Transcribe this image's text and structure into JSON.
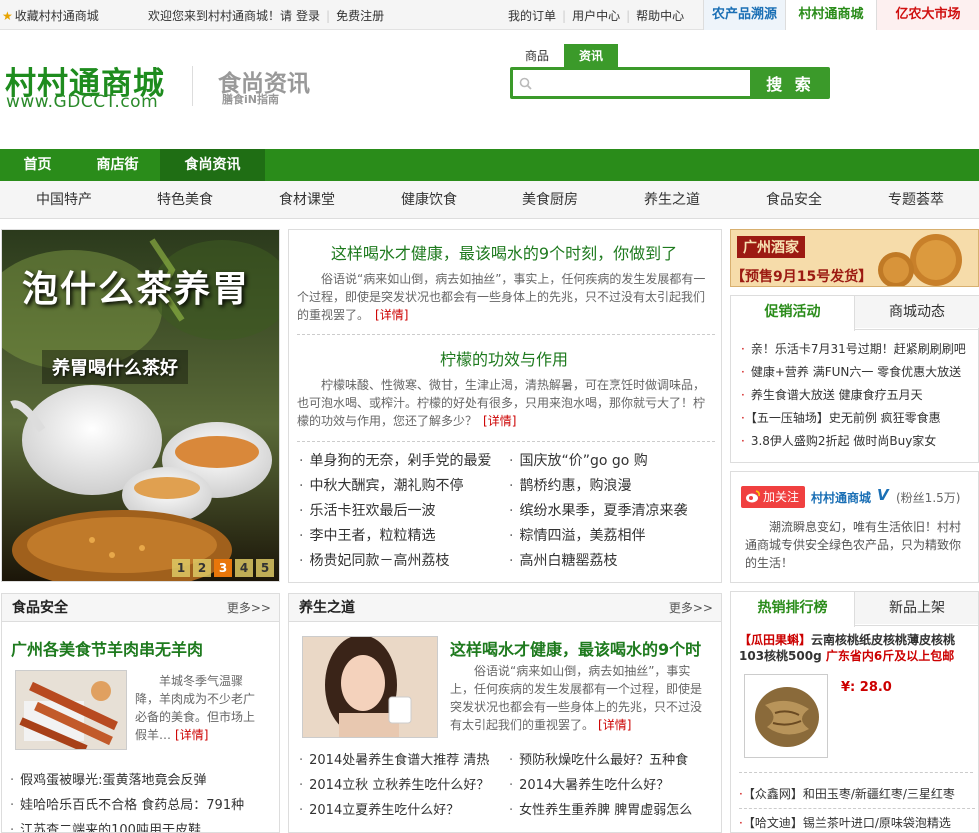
{
  "topbar": {
    "favorite": "收藏村村通商城",
    "welcome": "欢迎您来到村村通商城！请",
    "login": "登录",
    "register": "免费注册",
    "links": [
      "我的订单",
      "用户中心",
      "帮助中心"
    ],
    "tabs": [
      "农产品溯源",
      "村村通商城",
      "亿农大市场"
    ]
  },
  "header": {
    "logo": "村村通商城",
    "logo_url": "www.GDCCT.com",
    "sub_logo": "食尚资讯",
    "sub_logo_tag": "膳食iN指南",
    "search_tabs": [
      "商品",
      "资讯"
    ],
    "search_button": "搜 索"
  },
  "mainnav": [
    "首页",
    "商店街",
    "食尚资讯"
  ],
  "subnav": [
    "中国特产",
    "特色美食",
    "食材课堂",
    "健康饮食",
    "美食厨房",
    "养生之道",
    "食品安全",
    "专题荟萃"
  ],
  "banner": {
    "title": "泡什么茶养胃",
    "subtitle": "养胃喝什么茶好",
    "pages": [
      "1",
      "2",
      "3",
      "4",
      "5"
    ],
    "active_page": "3"
  },
  "articles": [
    {
      "title": "这样喝水才健康，最该喝水的9个时刻，你做到了",
      "text": "俗语说“病来如山倒，病去如抽丝”，事实上，任何疾病的发生发展都有一个过程，即使是突发状况也都会有一些身体上的先兆，只不过没有太引起我们的重视罢了。",
      "more": "[详情]"
    },
    {
      "title": "柠檬的功效与作用",
      "text": "柠檬味酸、性微寒、微甘，生津止渴，清热解暑，可在烹饪时做调味品，也可泡水喝、或榨汁。柠檬的好处有很多，只用来泡水喝，那你就亏大了！柠檬的功效与作用，您还了解多少？",
      "more": "[详情]"
    }
  ],
  "center_list": {
    "left": [
      "单身狗的无奈，剁手党的最爱",
      "中秋大酬宾，潮礼购不停",
      "乐活卡狂欢最后一波",
      "李中王者，粒粒精选",
      "杨贵妃同款－高州荔枝"
    ],
    "right": [
      "国庆放“价”go go 购",
      "鹊桥约惠，购浪漫",
      "缤纷水果季，夏季清凉来袭",
      "粽情四溢，美荔相伴",
      "高州白糖罂荔枝"
    ]
  },
  "ad": {
    "shop": "广州酒家",
    "text": "【预售9月15号发货】"
  },
  "promo": {
    "tabs": [
      "促销活动",
      "商城动态"
    ],
    "items": [
      "亲！乐活卡7月31号过期！赶紧刷刷刷吧",
      "健康+营养 满FUN六一 零食优惠大放送",
      "养生食谱大放送 健康食疗五月天",
      "【五一压轴场】史无前例 疯狂零食惠",
      "3.8伊人盛购2折起 做时尚Buy家女"
    ]
  },
  "weibo": {
    "follow": "加关注",
    "name": "村村通商城",
    "verified": "V",
    "fans": "(粉丝1.5万)",
    "text": "潮流瞬息变幻，唯有生活依旧！村村通商城专供安全绿色农产品，只为精致你的生活！"
  },
  "food_safety": {
    "title": "食品安全",
    "more": "更多>>",
    "headline": "广州各美食节羊肉串无羊肉",
    "text": "羊城冬季气温骤降，羊肉成为不少老广必备的美食。但市场上假羊…",
    "detail": "[详情]",
    "items": [
      "假鸡蛋被曝光:蛋黄落地竟会反弹",
      "娃哈哈乐百氏不合格 食药总局：791种",
      "江苏查二端来的100吨用于皮鞋"
    ]
  },
  "health": {
    "title": "养生之道",
    "more": "更多>>",
    "headline": "这样喝水才健康，最该喝水的9个时",
    "text": "俗语说“病来如山倒，病去如抽丝”，事实上，任何疾病的发生发展都有一个过程，即使是突发状况也都会有一些身体上的先兆，只不过没有太引起我们的重视罢了。",
    "detail": "[详情]",
    "left": [
      "2014处暑养生食谱大推荐 清热",
      "2014立秋 立秋养生吃什么好？",
      "2014立夏养生吃什么好？"
    ],
    "right": [
      "预防秋燥吃什么最好？五种食",
      "2014大暑养生吃什么好？",
      "女性养生重养脾 脾胃虚弱怎么"
    ]
  },
  "ranking": {
    "tabs": [
      "热销排行榜",
      "新品上架"
    ],
    "product_tag": "【瓜田果蝌】",
    "product_name": "云南核桃纸皮核桃薄皮核桃103核桃500g",
    "product_promo": "广东省内6斤及以上包邮",
    "price": "¥: 28.0",
    "items": [
      "【众鑫网】和田玉枣/新疆红枣/三星红枣",
      "【哈文迪】锡兰茶叶进口/原味袋泡精选"
    ]
  },
  "colors": {
    "brand_green": "#2a8c1a",
    "dark_green": "#1f6e14",
    "accent_red": "#cc0000",
    "tab_blue": "#1a6fb5"
  }
}
